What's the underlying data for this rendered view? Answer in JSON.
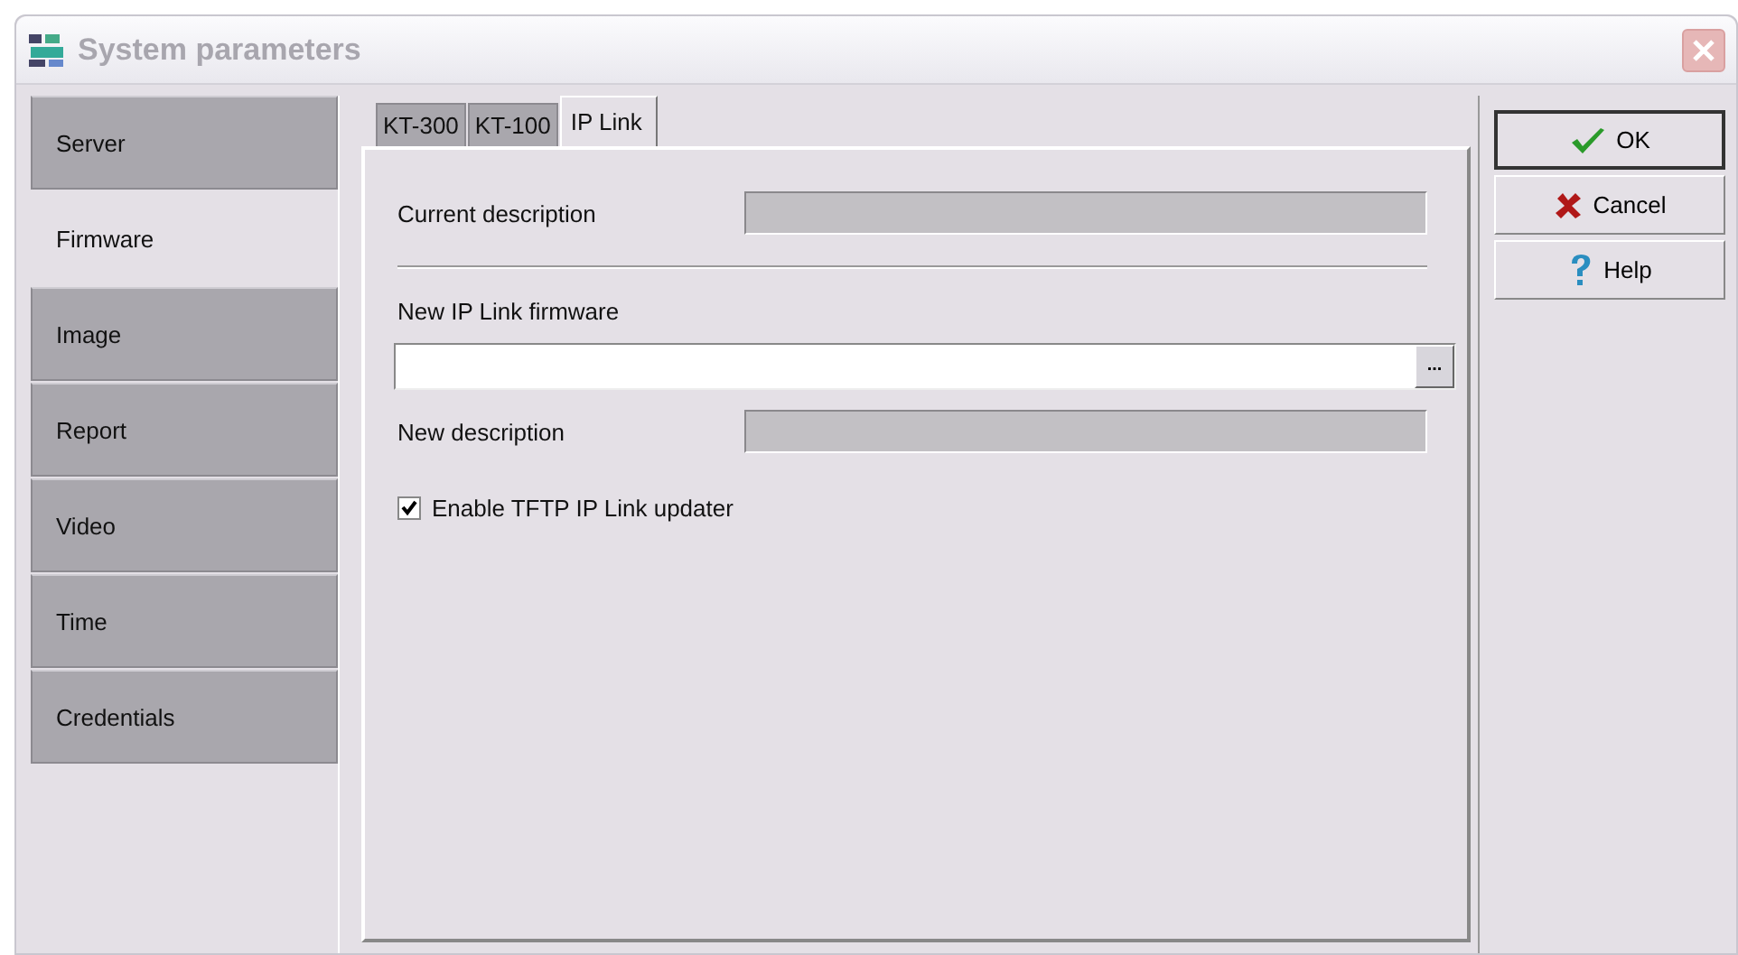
{
  "window": {
    "title": "System parameters"
  },
  "sidebar": {
    "items": [
      {
        "label": "Server",
        "selected": false
      },
      {
        "label": "Firmware",
        "selected": true
      },
      {
        "label": "Image",
        "selected": false
      },
      {
        "label": "Report",
        "selected": false
      },
      {
        "label": "Video",
        "selected": false
      },
      {
        "label": "Time",
        "selected": false
      },
      {
        "label": "Credentials",
        "selected": false
      }
    ]
  },
  "tabs": [
    {
      "label": "KT-300",
      "selected": false
    },
    {
      "label": "KT-100",
      "selected": false
    },
    {
      "label": "IP Link",
      "selected": true
    }
  ],
  "current_description": {
    "label": "Current description"
  },
  "new_firmware": {
    "label": "New IP Link firmware",
    "browse": "..."
  },
  "new_description": {
    "label": "New description"
  },
  "tftp_updater": {
    "label": "Enable TFTP IP Link updater",
    "checked": true
  },
  "buttons": [
    {
      "kind": "ok",
      "label": "OK",
      "default": true
    },
    {
      "kind": "cancel",
      "label": "Cancel",
      "default": false
    },
    {
      "kind": "help",
      "label": "Help",
      "default": false
    }
  ]
}
